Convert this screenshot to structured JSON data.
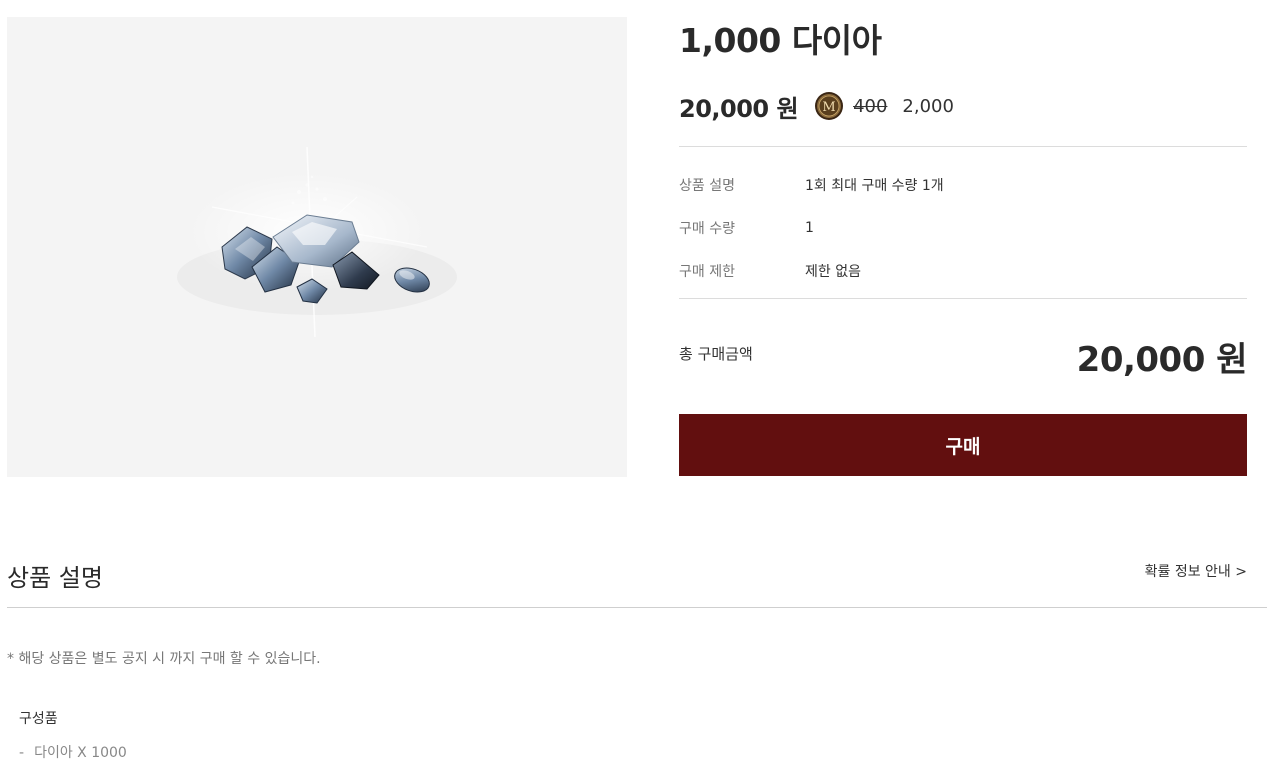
{
  "product": {
    "title": "1,000 다이아",
    "price_won": "20,000 원",
    "m_icon": "m-coin-icon",
    "price_old": "400",
    "price_m": "2,000"
  },
  "specs": [
    {
      "label": "상품 설명",
      "value": "1회 최대 구매 수량 1개"
    },
    {
      "label": "구매 수량",
      "value": "1"
    },
    {
      "label": "구매 제한",
      "value": "제한 없음"
    }
  ],
  "total": {
    "label": "총 구매금액",
    "value": "20,000 원"
  },
  "buy_button": {
    "label": "구매",
    "color": "#620f0f"
  },
  "description": {
    "title": "상품 설명",
    "prob_link": "확률 정보 안내 >",
    "notice": "* 해당 상품은 별도 공지 시 까지 구매 할 수 있습니다.",
    "components_title": "구성품",
    "components": [
      {
        "dash": "-",
        "text": "다이아 X 1000"
      }
    ]
  }
}
